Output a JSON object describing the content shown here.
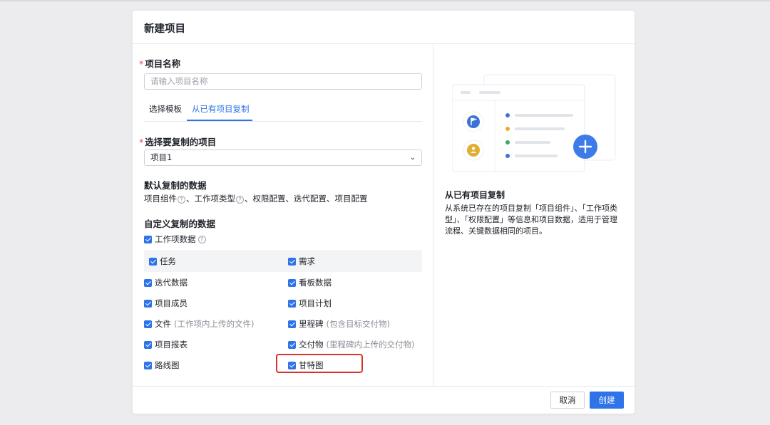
{
  "modal": {
    "title": "新建项目"
  },
  "form": {
    "name_label": "项目名称",
    "name_placeholder": "请输入项目名称",
    "required_mark": "*",
    "tabs": [
      {
        "label": "选择模板",
        "active": false
      },
      {
        "label": "从已有项目复制",
        "active": true
      }
    ],
    "copy_source_label": "选择要复制的项目",
    "copy_source_value": "项目1",
    "default_data_title": "默认复制的数据",
    "default_items": [
      "项目组件",
      "、工作项类型",
      "、权限配置、迭代配置、项目配置"
    ],
    "custom_data_title": "自定义复制的数据",
    "workitem_data": "工作项数据",
    "help_glyph": "?",
    "checkboxes": {
      "task": "任务",
      "requirement": "需求",
      "iteration": "迭代数据",
      "kanban": "看板数据",
      "members": "项目成员",
      "plan": "项目计划",
      "file": "文件",
      "file_note": "(工作项内上传的文件)",
      "milestone": "里程碑",
      "milestone_note": "(包含目标交付物)",
      "report": "项目报表",
      "deliverable": "交付物",
      "deliverable_note": "(里程碑内上传的交付物)",
      "roadmap": "路线图",
      "gantt": "甘特图"
    }
  },
  "side": {
    "title": "从已有项目复制",
    "description": "从系统已存在的项目复制「项目组件」、「工作项类型」、「权限配置」等信息和项目数据，适用于管理流程、关键数据相同的项目。"
  },
  "footer": {
    "cancel": "取消",
    "create": "创建"
  },
  "colors": {
    "accent": "#2e73e8",
    "highlight": "#d9342b",
    "required": "#e34d59"
  },
  "icons": [
    "flag-icon",
    "user-icon",
    "plus-icon",
    "chevron-down-icon",
    "help-icon",
    "checkbox-checked-icon"
  ]
}
